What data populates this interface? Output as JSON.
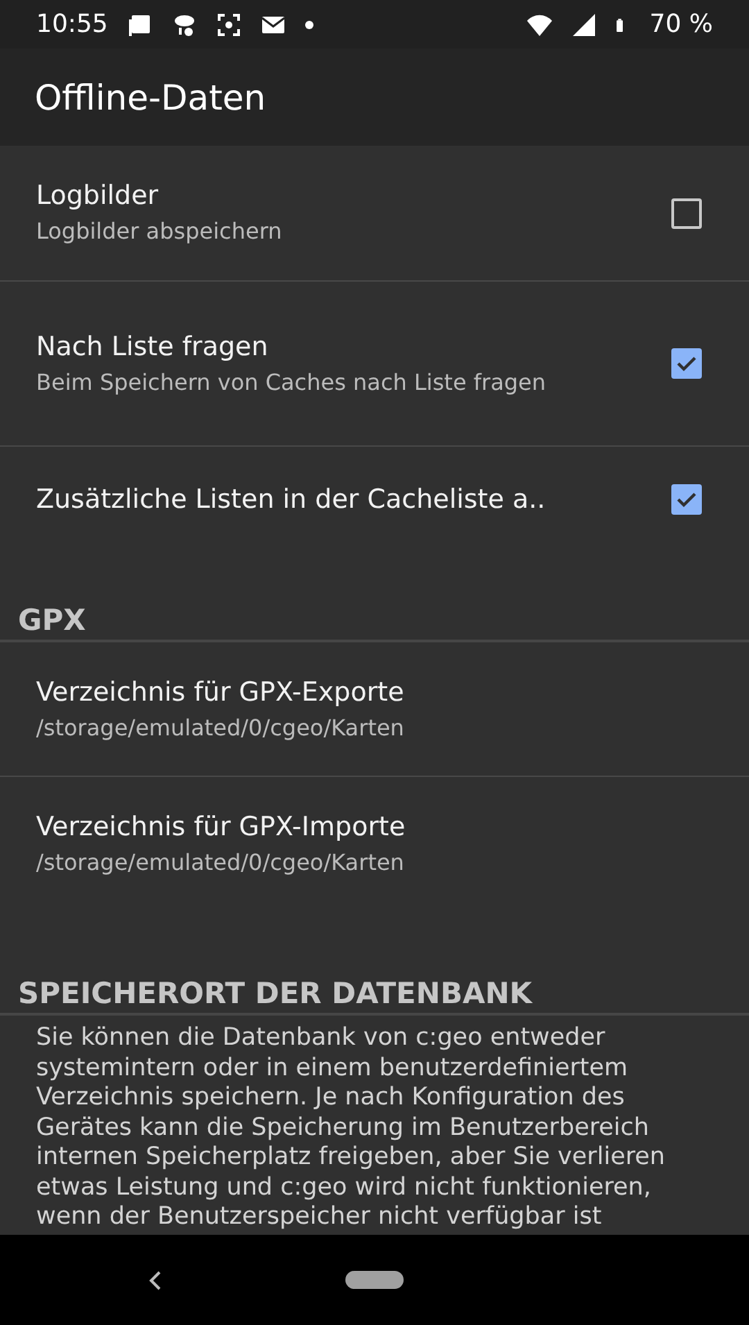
{
  "status_bar": {
    "time": "10:55",
    "battery": "70 %"
  },
  "app_bar": {
    "title": "Offline-Daten"
  },
  "items": [
    {
      "kind": "checkbox",
      "title": "Logbilder",
      "summary": "Logbilder abspeichern",
      "checked": false
    },
    {
      "kind": "checkbox",
      "title": "Nach Liste fragen",
      "summary": "Beim Speichern von Caches nach Liste fragen",
      "checked": true
    },
    {
      "kind": "checkbox",
      "title": "Zusätzliche Listen in der Cacheliste a..",
      "checked": true
    },
    {
      "kind": "header",
      "title": "GPX"
    },
    {
      "kind": "path",
      "title": "Verzeichnis für GPX-Exporte",
      "summary": "/storage/emulated/0/cgeo/Karten"
    },
    {
      "kind": "path",
      "title": "Verzeichnis für GPX-Importe",
      "summary": "/storage/emulated/0/cgeo/Karten"
    },
    {
      "kind": "header",
      "title": "SPEICHERORT DER DATENBANK"
    },
    {
      "kind": "text",
      "title": "Sie können die Datenbank von c:geo entweder systemintern oder in einem benutzerdefiniertem Verzeichnis speichern. Je nach Konfiguration des Gerätes kann die Speicherung im Benutzerbereich internen Speicherplatz freigeben, aber Sie verlieren etwas Leistung und c:geo wird nicht funktionieren, wenn der Benutzerspeicher nicht verfügbar ist"
    }
  ]
}
